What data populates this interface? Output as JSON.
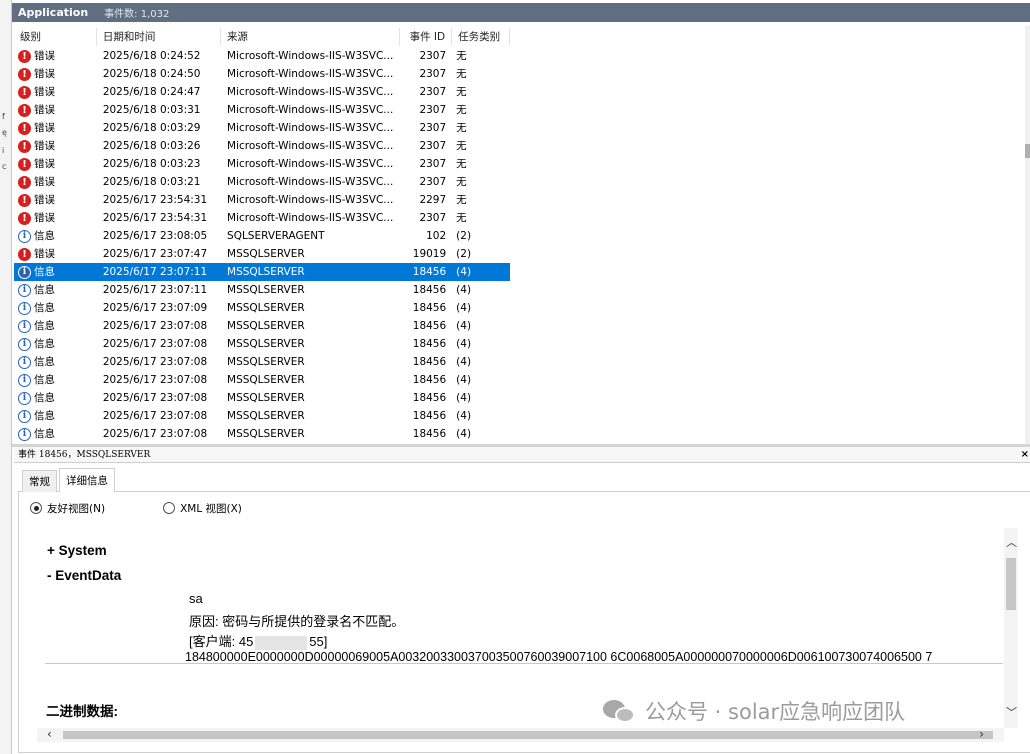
{
  "window": {
    "title": "Application",
    "count": "事件数: 1,032"
  },
  "columns": {
    "level": "级别",
    "date": "日期和时间",
    "source": "来源",
    "id": "事件 ID",
    "task": "任务类别"
  },
  "rows": [
    {
      "icon": "error",
      "level": "错误",
      "date": "2025/6/18 0:24:52",
      "source": "Microsoft-Windows-IIS-W3SVC...",
      "id": "2307",
      "task": "无"
    },
    {
      "icon": "error",
      "level": "错误",
      "date": "2025/6/18 0:24:50",
      "source": "Microsoft-Windows-IIS-W3SVC...",
      "id": "2307",
      "task": "无"
    },
    {
      "icon": "error",
      "level": "错误",
      "date": "2025/6/18 0:24:47",
      "source": "Microsoft-Windows-IIS-W3SVC...",
      "id": "2307",
      "task": "无"
    },
    {
      "icon": "error",
      "level": "错误",
      "date": "2025/6/18 0:03:31",
      "source": "Microsoft-Windows-IIS-W3SVC...",
      "id": "2307",
      "task": "无"
    },
    {
      "icon": "error",
      "level": "错误",
      "date": "2025/6/18 0:03:29",
      "source": "Microsoft-Windows-IIS-W3SVC...",
      "id": "2307",
      "task": "无"
    },
    {
      "icon": "error",
      "level": "错误",
      "date": "2025/6/18 0:03:26",
      "source": "Microsoft-Windows-IIS-W3SVC...",
      "id": "2307",
      "task": "无"
    },
    {
      "icon": "error",
      "level": "错误",
      "date": "2025/6/18 0:03:23",
      "source": "Microsoft-Windows-IIS-W3SVC...",
      "id": "2307",
      "task": "无"
    },
    {
      "icon": "error",
      "level": "错误",
      "date": "2025/6/18 0:03:21",
      "source": "Microsoft-Windows-IIS-W3SVC...",
      "id": "2307",
      "task": "无"
    },
    {
      "icon": "error",
      "level": "错误",
      "date": "2025/6/17 23:54:31",
      "source": "Microsoft-Windows-IIS-W3SVC...",
      "id": "2297",
      "task": "无"
    },
    {
      "icon": "error",
      "level": "错误",
      "date": "2025/6/17 23:54:31",
      "source": "Microsoft-Windows-IIS-W3SVC...",
      "id": "2307",
      "task": "无"
    },
    {
      "icon": "info",
      "level": "信息",
      "date": "2025/6/17 23:08:05",
      "source": "SQLSERVERAGENT",
      "id": "102",
      "task": "(2)"
    },
    {
      "icon": "error",
      "level": "错误",
      "date": "2025/6/17 23:07:47",
      "source": "MSSQLSERVER",
      "id": "19019",
      "task": "(2)"
    },
    {
      "icon": "info",
      "level": "信息",
      "date": "2025/6/17 23:07:11",
      "source": "MSSQLSERVER",
      "id": "18456",
      "task": "(4)",
      "selected": true
    },
    {
      "icon": "info",
      "level": "信息",
      "date": "2025/6/17 23:07:11",
      "source": "MSSQLSERVER",
      "id": "18456",
      "task": "(4)"
    },
    {
      "icon": "info",
      "level": "信息",
      "date": "2025/6/17 23:07:09",
      "source": "MSSQLSERVER",
      "id": "18456",
      "task": "(4)"
    },
    {
      "icon": "info",
      "level": "信息",
      "date": "2025/6/17 23:07:08",
      "source": "MSSQLSERVER",
      "id": "18456",
      "task": "(4)"
    },
    {
      "icon": "info",
      "level": "信息",
      "date": "2025/6/17 23:07:08",
      "source": "MSSQLSERVER",
      "id": "18456",
      "task": "(4)"
    },
    {
      "icon": "info",
      "level": "信息",
      "date": "2025/6/17 23:07:08",
      "source": "MSSQLSERVER",
      "id": "18456",
      "task": "(4)"
    },
    {
      "icon": "info",
      "level": "信息",
      "date": "2025/6/17 23:07:08",
      "source": "MSSQLSERVER",
      "id": "18456",
      "task": "(4)"
    },
    {
      "icon": "info",
      "level": "信息",
      "date": "2025/6/17 23:07:08",
      "source": "MSSQLSERVER",
      "id": "18456",
      "task": "(4)"
    },
    {
      "icon": "info",
      "level": "信息",
      "date": "2025/6/17 23:07:08",
      "source": "MSSQLSERVER",
      "id": "18456",
      "task": "(4)"
    },
    {
      "icon": "info",
      "level": "信息",
      "date": "2025/6/17 23:07:08",
      "source": "MSSQLSERVER",
      "id": "18456",
      "task": "(4)"
    },
    {
      "icon": "info",
      "level": "信息",
      "date": "2025/6/17 23:07:08",
      "source": "MSSQLSERVER",
      "id": "18456",
      "task": "(4)"
    }
  ],
  "detail": {
    "header": "事件 18456，MSSQLSERVER",
    "close_glyph": "×",
    "tabs": [
      "常规",
      "详细信息"
    ],
    "active_tab": "详细信息",
    "views": {
      "friendly": "友好视图(N)",
      "xml": "XML 视图(X)",
      "selected": "friendly"
    },
    "system": "+ System",
    "eventdata": "- EventData",
    "lines": {
      "user": "sa",
      "reason": "原因: 密码与所提供的登录名不匹配。",
      "client_prefix": "[客户端: 45",
      "client_suffix": "55]",
      "hex": "184800000E0000000D00000069005A003200330037003500760039007100 6C0068005A000000070000006D006100730074006500 7"
    },
    "binary": "二进制数据:"
  },
  "watermark": "公众号 · solar应急响应团队",
  "colors": {
    "title_bar": "#5f6e80",
    "selection": "#0078d7",
    "error": "#d62020",
    "info": "#2a62b8"
  },
  "icons": {
    "error": "error-icon",
    "info": "info-icon",
    "wechat": "wechat-icon"
  }
}
